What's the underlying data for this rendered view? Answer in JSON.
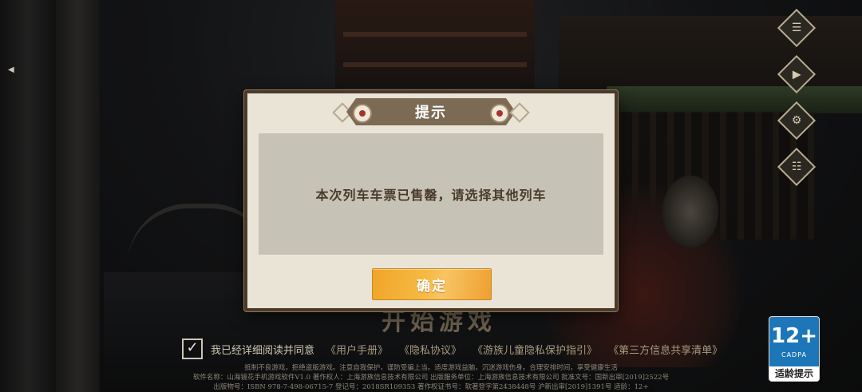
{
  "dialog": {
    "title": "提示",
    "message": "本次列车车票已售罄，请选择其他列车",
    "confirm_label": "确定"
  },
  "background": {
    "start_label": "开始游戏",
    "agreement": {
      "text": "我已经详细阅读并同意",
      "links": [
        "《用户手册》",
        "《隐私协议》",
        "《游族儿童隐私保护指引》",
        "《第三方信息共享清单》"
      ]
    },
    "disclaimer": [
      "抵制不良游戏，拒绝盗版游戏。注意自我保护，谨防受骗上当。适度游戏益脑，沉迷游戏伤身。合理安排时间，享受健康生活",
      "软件名称：山海镜花手机游戏软件V1.0    著作权人：上海游族信息技术有限公司    出版服务单位：上海游族信息技术有限公司    批准文号：国新出审[2019]2522号",
      "出版物号：ISBN 978-7-498-06715-7    登记号：2018SR109353    著作权证书号：软著登字第2438448号    沪新出审[2019]1391号    适龄：12+"
    ],
    "age_rating": {
      "number": "12+",
      "org": "CADPA",
      "label": "适龄提示"
    },
    "side_icons": [
      "notice-icon",
      "video-icon",
      "settings-icon",
      "account-icon"
    ]
  },
  "colors": {
    "dialog_bg": "#e9e4d5",
    "dialog_border": "#4b3a2a",
    "header_bar": "#7c6a55",
    "body_bg": "#c7c2b6",
    "message_text": "#4a3b2b",
    "confirm_button": "#f6ba45",
    "age_badge_blue": "#1d76b8"
  }
}
